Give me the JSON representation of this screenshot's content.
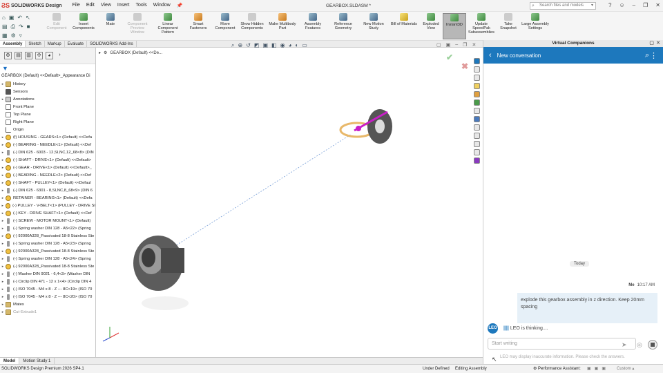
{
  "app": {
    "brand": "SOLIDWORKS Design",
    "doc_title": "GEARBOX.SLDASM *"
  },
  "menu": [
    "File",
    "Edit",
    "View",
    "Insert",
    "Tools",
    "Window"
  ],
  "search": {
    "placeholder": "Search files and models"
  },
  "tools": [
    {
      "label": "Edit Component",
      "icon": "edit-component-icon",
      "color": "gray",
      "disabled": true
    },
    {
      "label": "Insert Components",
      "icon": "insert-components-icon",
      "color": "green"
    },
    {
      "label": "Mate",
      "icon": "mate-icon",
      "color": "blue"
    },
    {
      "label": "Component Preview Window",
      "icon": "component-preview-icon",
      "color": "gray",
      "disabled": true
    },
    {
      "label": "Linear Component Pattern",
      "icon": "linear-pattern-icon",
      "color": "green"
    },
    {
      "label": "Smart Fasteners",
      "icon": "smart-fasteners-icon",
      "color": "orange"
    },
    {
      "label": "Move Component",
      "icon": "move-component-icon",
      "color": "blue"
    },
    {
      "label": "Show Hidden Components",
      "icon": "show-hidden-icon",
      "color": "gray"
    },
    {
      "label": "Make Multibody Part",
      "icon": "multibody-part-icon",
      "color": "orange"
    },
    {
      "label": "Assembly Features",
      "icon": "assembly-features-icon",
      "color": "blue"
    },
    {
      "label": "Reference Geometry",
      "icon": "reference-geometry-icon",
      "color": "blue"
    },
    {
      "label": "New Motion Study",
      "icon": "motion-study-icon",
      "color": "blue"
    },
    {
      "label": "Bill of Materials",
      "icon": "bom-icon",
      "color": "yellow"
    },
    {
      "label": "Exploded View",
      "icon": "exploded-view-icon",
      "color": "green"
    },
    {
      "label": "Instant3D",
      "icon": "instant3d-icon",
      "color": "green",
      "active": true
    },
    {
      "label": "Update SpeedPak Subassemblies",
      "icon": "speedpak-icon",
      "color": "green"
    },
    {
      "label": "Take Snapshot",
      "icon": "snapshot-icon",
      "color": "gray"
    },
    {
      "label": "Large Assembly Settings",
      "icon": "large-assembly-icon",
      "color": "green"
    }
  ],
  "cm_tabs": [
    "Assembly",
    "Sketch",
    "Markup",
    "Evaluate",
    "SOLIDWORKS Add-Ins"
  ],
  "feature_tree": {
    "root": "GEARBOX (Default) <<Default>_Appearance Di",
    "items": [
      {
        "text": "History",
        "icon": "fold",
        "tw": "▸"
      },
      {
        "text": "Sensors",
        "icon": "sens",
        "tw": ""
      },
      {
        "text": "Annotations",
        "icon": "ann",
        "tw": "▸"
      },
      {
        "text": "Front Plane",
        "icon": "plane",
        "tw": ""
      },
      {
        "text": "Top Plane",
        "icon": "plane",
        "tw": ""
      },
      {
        "text": "Right Plane",
        "icon": "plane",
        "tw": ""
      },
      {
        "text": "Origin",
        "icon": "orig",
        "tw": ""
      },
      {
        "text": "(f) HOUSING - GEARS<1> (Default) <<Defa",
        "icon": "part",
        "tw": "▸"
      },
      {
        "text": "(-) BEARING - NEEDLE<1> (Default) <<Def",
        "icon": "part",
        "tw": "▸"
      },
      {
        "text": "(-) DIN 625 - 6003 - 12,SI,NC,12_68<8> (DIN",
        "icon": "screw",
        "tw": "▸"
      },
      {
        "text": "(-) SHAFT - DRIVE<1> (Default) <<Default>",
        "icon": "part",
        "tw": "▸"
      },
      {
        "text": "(-) GEAR - DRIVE<1> (Default) <<Default>_",
        "icon": "part",
        "tw": "▸"
      },
      {
        "text": "(-) BEARING - NEEDLE<2> (Default) <<Def",
        "icon": "part",
        "tw": "▸"
      },
      {
        "text": "(-) SHAFT - PULLEY<1> (Default) <<Defaul",
        "icon": "part",
        "tw": "▸"
      },
      {
        "text": "(-) DIN 625 - 6301 - 8,SI,NC,8_68<9> (DIN 6",
        "icon": "screw",
        "tw": "▸"
      },
      {
        "text": "RETAINER - BEARING<1> (Default) <<Defa",
        "icon": "part",
        "tw": "▸"
      },
      {
        "text": "(-) PULLEY - V-BELT<1> (PULLEY - DRIVE SI",
        "icon": "part",
        "tw": "▸"
      },
      {
        "text": "(-) KEY - DRIVE SHAFT<1> (Default) <<Def",
        "icon": "part",
        "tw": "▸"
      },
      {
        "text": "(-) SCREW - MOTOR MOUNT<1> (Default)",
        "icon": "screw",
        "tw": "▸"
      },
      {
        "text": "(-) Spring washer DIN 128 - A5<22> (Spring",
        "icon": "screw",
        "tw": "▸"
      },
      {
        "text": "(-) 92000A328_Passivated 18-8 Stainless Ste",
        "icon": "part",
        "tw": "▸"
      },
      {
        "text": "(-) Spring washer DIN 128 - A5<23> (Spring",
        "icon": "screw",
        "tw": "▸"
      },
      {
        "text": "(-) 92000A328_Passivated 18-8 Stainless Ste",
        "icon": "part",
        "tw": "▸"
      },
      {
        "text": "(-) Spring washer DIN 128 - A5<24> (Spring",
        "icon": "screw",
        "tw": "▸"
      },
      {
        "text": "(-) 92000A328_Passivated 18-8 Stainless Ste",
        "icon": "part",
        "tw": "▸"
      },
      {
        "text": "(-) Washer DIN 9021 - 6,4<3> (Washer DIN",
        "icon": "screw",
        "tw": "▸"
      },
      {
        "text": "(-) Circlip DIN 471 - 12 x 1<4> (Circlip DIN 4",
        "icon": "screw",
        "tw": "▸"
      },
      {
        "text": "(-) ISO 7045 - M4 x 8 - Z --- 8C<19> (ISO 70",
        "icon": "screw",
        "tw": "▸"
      },
      {
        "text": "(-) ISO 7045 - M4 x 8 - Z --- 8C<20> (ISO 70",
        "icon": "screw",
        "tw": "▸"
      },
      {
        "text": "Mates",
        "icon": "fold",
        "tw": "▸"
      },
      {
        "text": "Cut-Extrude1",
        "icon": "fold",
        "tw": "▸",
        "dim": true
      }
    ]
  },
  "breadcrumb": "GEARBOX (Default) <<De...",
  "bottom_tabs": [
    "Model",
    "Motion Study 1"
  ],
  "vc": {
    "panel_title": "Virtual Companions",
    "header": "New conversation",
    "today": "Today",
    "sender": "Me",
    "time": "10:17 AM",
    "message": "explode this gearbox assembly in z direction. Keep 20mm spacing",
    "avatar": "LEO",
    "thinking": "LEO is thinking....",
    "input_placeholder": "Start writing",
    "disclaimer": "LEO may display inaccurate information. Please check the answers."
  },
  "status": {
    "product": "SOLIDWORKS Design Premium 2026 SP4.1",
    "state1": "Under Defined",
    "state2": "Editing Assembly",
    "assistant": "Performance Assistant:",
    "units": "Custom"
  }
}
